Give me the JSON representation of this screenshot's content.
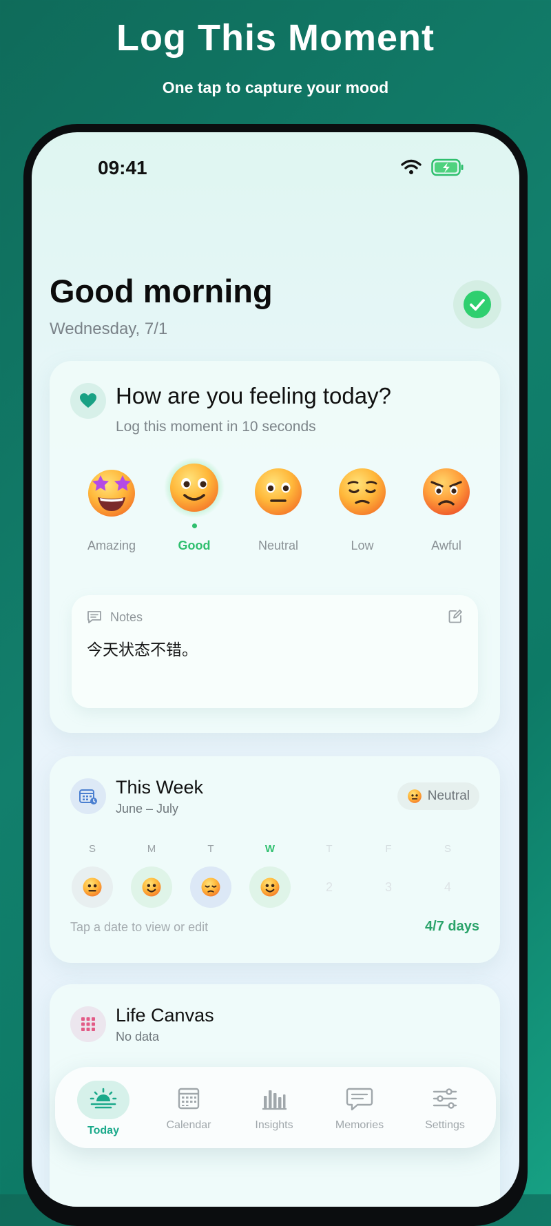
{
  "promo": {
    "headline": "Log This Moment",
    "subhead": "One tap to capture your mood"
  },
  "status_bar": {
    "time": "09:41"
  },
  "header": {
    "greeting": "Good morning",
    "date": "Wednesday, 7/1"
  },
  "mood_card": {
    "title": "How are you feeling today?",
    "subtitle": "Log this moment in 10 seconds",
    "moods": [
      {
        "label": "Amazing"
      },
      {
        "label": "Good"
      },
      {
        "label": "Neutral"
      },
      {
        "label": "Low"
      },
      {
        "label": "Awful"
      }
    ],
    "selected": "Good",
    "notes_label": "Notes",
    "notes_text": "今天状态不错。"
  },
  "week_card": {
    "title": "This Week",
    "range": "June – July",
    "badge": "Neutral",
    "days": [
      {
        "letter": "S",
        "mood": "Neutral"
      },
      {
        "letter": "M",
        "mood": "Good"
      },
      {
        "letter": "T",
        "mood": "Low"
      },
      {
        "letter": "W",
        "mood": "Good",
        "today": true
      },
      {
        "letter": "T",
        "num": "2"
      },
      {
        "letter": "F",
        "num": "3"
      },
      {
        "letter": "S",
        "num": "4"
      }
    ],
    "hint": "Tap a date to view or edit",
    "count": "4/7 days"
  },
  "canvas_card": {
    "title": "Life Canvas",
    "subtitle": "No data"
  },
  "tabs": [
    {
      "label": "Today",
      "icon": "sunrise-icon",
      "active": true
    },
    {
      "label": "Calendar",
      "icon": "calendar-icon"
    },
    {
      "label": "Insights",
      "icon": "bar-chart-icon"
    },
    {
      "label": "Memories",
      "icon": "speech-bubble-icon"
    },
    {
      "label": "Settings",
      "icon": "sliders-icon"
    }
  ],
  "colors": {
    "accent": "#2fbf6e",
    "tab_accent": "#1aa98a",
    "background": "#0f6b5a"
  }
}
